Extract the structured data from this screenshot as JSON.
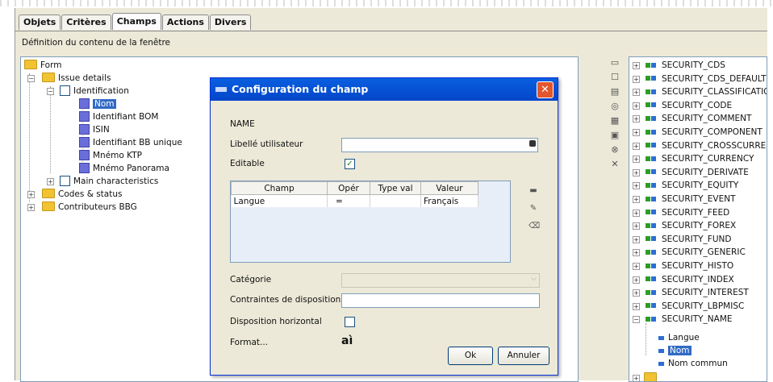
{
  "tabs": [
    "Objets",
    "Critères",
    "Champs",
    "Actions",
    "Divers"
  ],
  "active_tab": "Champs",
  "section_title": "Définition du contenu de la fenêtre",
  "left_tree": {
    "root": "Form",
    "issue_details": "Issue details",
    "identification": "Identification",
    "fields": [
      "Nom",
      "Identifiant BOM",
      "ISIN",
      "Identifiant BB unique",
      "Mnémo KTP",
      "Mnémo Panorama"
    ],
    "main_characteristics": "Main characteristics",
    "codes_status": "Codes & status",
    "contributeurs": "Contributeurs BBG"
  },
  "right_tree": {
    "items": [
      "SECURITY_CDS",
      "SECURITY_CDS_DEFAULT",
      "SECURITY_CLASSIFICATION",
      "SECURITY_CODE",
      "SECURITY_COMMENT",
      "SECURITY_COMPONENT",
      "SECURITY_CROSSCURRENCY",
      "SECURITY_CURRENCY",
      "SECURITY_DERIVATE",
      "SECURITY_EQUITY",
      "SECURITY_EVENT",
      "SECURITY_FEED",
      "SECURITY_FOREX",
      "SECURITY_FUND",
      "SECURITY_GENERIC",
      "SECURITY_HISTO",
      "SECURITY_INDEX",
      "SECURITY_INTEREST",
      "SECURITY_LBPMISC",
      "SECURITY_NAME"
    ],
    "children": [
      "Langue",
      "Nom",
      "Nom commun"
    ]
  },
  "dialog": {
    "title": "Configuration du champ",
    "field_name": "NAME",
    "libelle_label": "Libellé utilisateur",
    "libelle_value": "",
    "editable_label": "Editable",
    "editable_checked": true,
    "grid": {
      "headers": [
        "Champ",
        "Opér",
        "Type val",
        "Valeur"
      ],
      "rows": [
        [
          "Langue",
          "=",
          "",
          "Français"
        ]
      ]
    },
    "categorie_label": "Catégorie",
    "contraintes_label": "Contraintes de disposition",
    "disposition_label": "Disposition horizontal",
    "disposition_checked": false,
    "format_label": "Format...",
    "format_icon_text": "aì",
    "ok_label": "Ok",
    "cancel_label": "Annuler"
  }
}
